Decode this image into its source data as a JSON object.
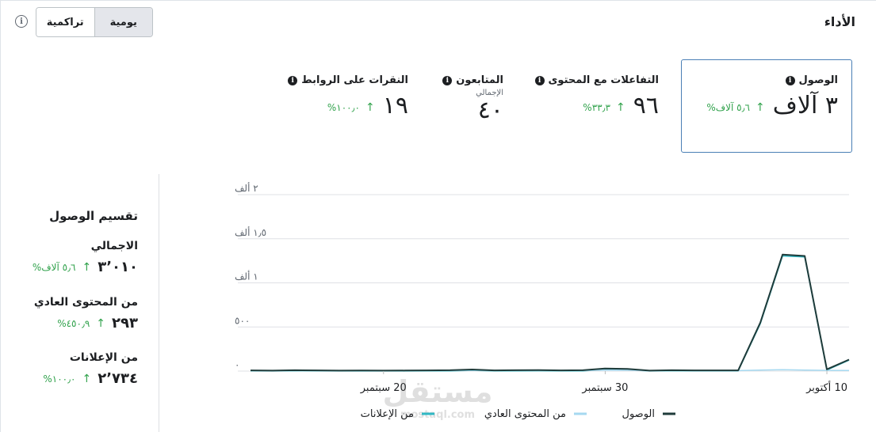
{
  "header": {
    "title": "الأداء",
    "toggle": {
      "daily": "يومية",
      "cumulative": "تراكمية"
    },
    "info_symbol": "i"
  },
  "metrics": [
    {
      "key": "reach",
      "label": "الوصول",
      "value": "٣ آلاف",
      "change": "٥٫٦ آلاف%",
      "selected": true
    },
    {
      "key": "engagement",
      "label": "التفاعلات مع المحتوى",
      "value": "٩٦",
      "change": "٣٣٫٣%"
    },
    {
      "key": "followers",
      "label": "المتابعون",
      "sublabel": "الإجمالي",
      "value": "٤٠",
      "change": ""
    },
    {
      "key": "link_clicks",
      "label": "النقرات على الروابط",
      "value": "١٩",
      "change": "١٠٠٫٠%"
    }
  ],
  "breakdown": {
    "title": "تقسيم الوصول",
    "items": [
      {
        "label": "الاجمالي",
        "value": "٣٬٠١٠",
        "change": "٥٫٦ آلاف%"
      },
      {
        "label": "من المحتوى العادي",
        "value": "٢٩٣",
        "change": "٤٥٠٫٩%"
      },
      {
        "label": "من الإعلانات",
        "value": "٢٬٧٣٤",
        "change": "١٠٠٫٠%"
      }
    ]
  },
  "chart_data": {
    "type": "line",
    "title": "",
    "y_tick_labels": [
      "٠",
      "٥٠٠",
      "١ ألف",
      "١٫٥ ألف",
      "٢ ألف"
    ],
    "y_ticks": [
      0,
      500,
      1000,
      1500,
      2000
    ],
    "ylim": [
      0,
      2000
    ],
    "x_tick_labels": [
      {
        "label": "20 سبتمبر",
        "day_index": 6
      },
      {
        "label": "30 سبتمبر",
        "day_index": 16
      },
      {
        "label": "10 أكتوبر",
        "day_index": 26
      }
    ],
    "x_count": 28,
    "series": [
      {
        "name": "الوصول",
        "color": "#1f3b3a",
        "values": [
          8,
          5,
          10,
          8,
          5,
          6,
          5,
          6,
          8,
          10,
          18,
          8,
          10,
          12,
          8,
          10,
          30,
          25,
          5,
          10,
          8,
          8,
          8,
          550,
          1320,
          1305,
          20,
          130
        ]
      },
      {
        "name": "من المحتوى العادي",
        "color": "#a6d9f0",
        "values": [
          5,
          4,
          6,
          5,
          4,
          5,
          4,
          5,
          6,
          7,
          10,
          6,
          7,
          8,
          6,
          7,
          12,
          10,
          4,
          6,
          5,
          5,
          5,
          12,
          15,
          12,
          8,
          6
        ]
      },
      {
        "name": "من الإعلانات",
        "color": "#30b8c4",
        "values": [
          3,
          1,
          4,
          3,
          1,
          1,
          1,
          1,
          2,
          3,
          8,
          2,
          3,
          4,
          2,
          3,
          18,
          15,
          1,
          4,
          3,
          3,
          3,
          538,
          1305,
          1293,
          12,
          124
        ]
      }
    ],
    "legend_position": "bottom"
  },
  "watermark": {
    "brand_ar": "مستقل",
    "brand_en": "mostaql.com"
  }
}
